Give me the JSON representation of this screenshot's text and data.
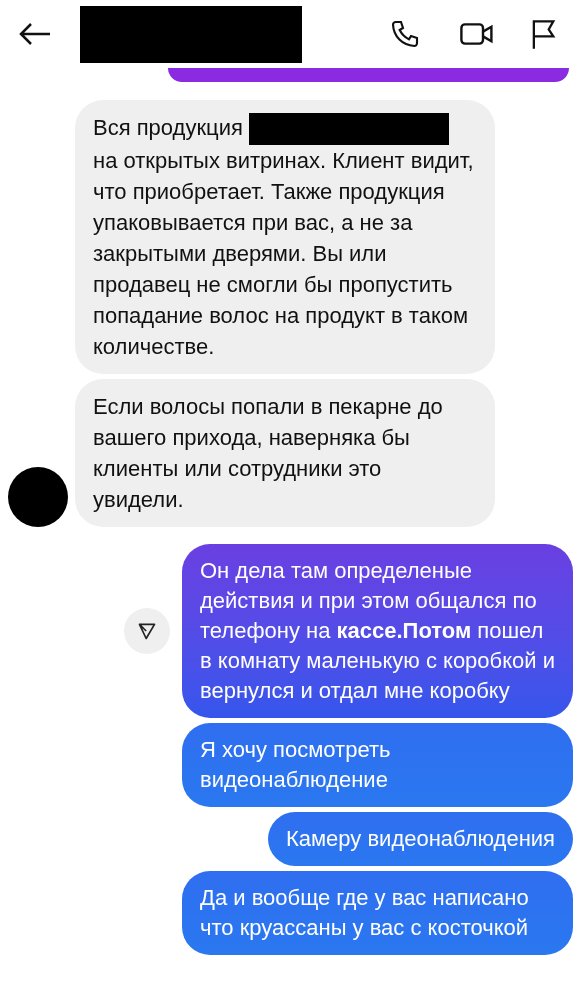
{
  "messages": [
    {
      "kind": "received",
      "text": "Вся продукция",
      "continuation": "на открытых витринах. Клиент видит, что приобретает. Также продукция упаковывается при вас, а не за закрытыми дверями. Вы или продавец не смогли бы пропустить попадание волос на продукт в таком количестве.",
      "show_avatar": false
    },
    {
      "kind": "received",
      "text": "Если волосы попали в пекарне до вашего прихода, наверняка бы клиенты или сотрудники это увидели.",
      "show_avatar": true
    },
    {
      "kind": "sent",
      "text": "Он дела там определеные действия и при этом общался по телефону на **кассе.Потом** пошел в комнату маленькую с коробкой и вернулся и отдал мне коробку",
      "share_button": true
    },
    {
      "kind": "sent",
      "text": "Я хочу посмотреть видеонаблюдение",
      "share_button": false
    },
    {
      "kind": "sent",
      "text": "Камеру видеонаблюдения",
      "share_button": false
    },
    {
      "kind": "sent",
      "text": "Да и вообще где у вас написано что круассаны у вас с косточкой",
      "share_button": false
    }
  ]
}
